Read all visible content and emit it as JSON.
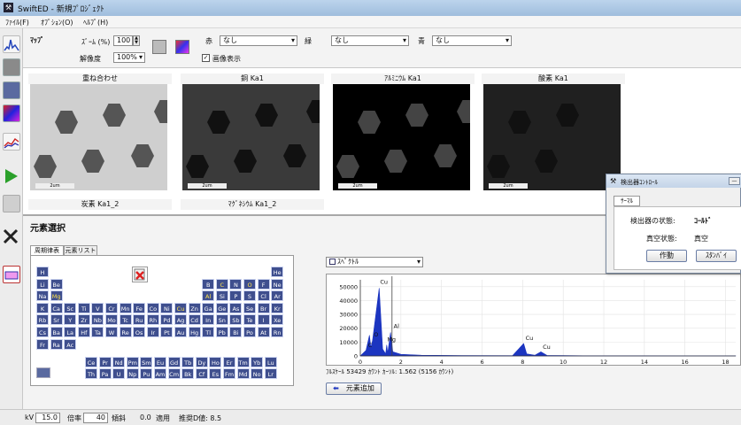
{
  "window": {
    "title": "SwiftED - 新規ﾌﾟﾛｼﾞｪｸﾄ"
  },
  "menu": [
    "ﾌｧｲﾙ(F)",
    "ｵﾌﾟｼｮﾝ(O)",
    "ﾍﾙﾌﾟ(H)"
  ],
  "map_panel": {
    "section_label": "ﾏｯﾌﾟ",
    "zoom_label": "ｽﾞｰﾑ (%)",
    "zoom_value": "100",
    "resolution_label": "解像度",
    "resolution_value": "100%",
    "red_label": "赤",
    "red_value": "なし",
    "green_label": "緑",
    "green_value": "なし",
    "blue_label": "青",
    "blue_value": "なし",
    "image_display_label": "画像表示",
    "maps": [
      {
        "caption": "重ね合わせ",
        "scale": "2um"
      },
      {
        "caption": "銅 Ka1",
        "scale": "2um"
      },
      {
        "caption": "ｱﾙﾐﾆｳﾑ Ka1",
        "scale": "2um"
      },
      {
        "caption": "酸素 Ka1",
        "scale": "2um"
      }
    ],
    "second_row_captions": [
      "炭素 Ka1_2",
      "ﾏｸﾞﾈｼｳﾑ Ka1_2"
    ]
  },
  "element_section": {
    "title": "元素選択",
    "tabs": [
      "周期律表",
      "元素リスト"
    ],
    "periodic_rows": [
      [
        "H",
        "",
        "",
        "",
        "",
        "",
        "",
        "",
        "",
        "",
        "",
        "",
        "",
        "",
        "",
        "",
        "",
        "He"
      ],
      [
        "Li",
        "Be",
        "",
        "",
        "",
        "",
        "",
        "",
        "",
        "",
        "",
        "",
        "B",
        "C",
        "N",
        "O",
        "F",
        "Ne"
      ],
      [
        "Na",
        "Mg",
        "",
        "",
        "",
        "",
        "",
        "",
        "",
        "",
        "",
        "",
        "Al",
        "Si",
        "P",
        "S",
        "Cl",
        "Ar"
      ],
      [
        "K",
        "Ca",
        "Sc",
        "Ti",
        "V",
        "Cr",
        "Mn",
        "Fe",
        "Co",
        "Ni",
        "Cu",
        "Zn",
        "Ga",
        "Ge",
        "As",
        "Se",
        "Br",
        "Kr"
      ],
      [
        "Rb",
        "Sr",
        "Y",
        "Zr",
        "Nb",
        "Mo",
        "Tc",
        "Ru",
        "Rh",
        "Pd",
        "Ag",
        "Cd",
        "In",
        "Sn",
        "Sb",
        "Te",
        "I",
        "Xe"
      ],
      [
        "Cs",
        "Ba",
        "La",
        "Hf",
        "Ta",
        "W",
        "Re",
        "Os",
        "Ir",
        "Pt",
        "Au",
        "Hg",
        "Tl",
        "Pb",
        "Bi",
        "Po",
        "At",
        "Rn"
      ],
      [
        "Fr",
        "Ra",
        "Ac",
        "",
        "",
        "",
        "",
        "",
        "",
        "",
        "",
        "",
        "",
        "",
        "",
        "",
        "",
        ""
      ]
    ],
    "lanthanides": [
      "Ce",
      "Pr",
      "Nd",
      "Pm",
      "Sm",
      "Eu",
      "Gd",
      "Tb",
      "Dy",
      "Ho",
      "Er",
      "Tm",
      "Yb",
      "Lu"
    ],
    "actinides": [
      "Th",
      "Pa",
      "U",
      "Np",
      "Pu",
      "Am",
      "Cm",
      "Bk",
      "Cf",
      "Es",
      "Fm",
      "Md",
      "No",
      "Lr"
    ],
    "highlighted": [
      "Mg",
      "Al",
      "Cu",
      "O",
      "C"
    ]
  },
  "spectrum": {
    "view_value": "ｽﾍﾟｸﾄﾙ",
    "fullscale_text": "ﾌﾙｽｹｰﾙ 53429 ｶｳﾝﾄ  ｶｰｿﾙ: 1.562  (5156 ｶｳﾝﾄ)",
    "add_element_label": "元素追加",
    "peak_labels": [
      "C",
      "O",
      "Cu",
      "Mg",
      "Al",
      "Cu",
      "Cu"
    ],
    "y_ticks": [
      "50000",
      "40000",
      "30000",
      "20000",
      "10000",
      "0"
    ],
    "x_ticks": [
      "0",
      "2",
      "4",
      "6",
      "8",
      "10",
      "12",
      "14",
      "16",
      "18"
    ]
  },
  "chart_data": {
    "type": "line",
    "title": "",
    "xlabel": "",
    "ylabel": "",
    "xlim": [
      0,
      18.5
    ],
    "ylim": [
      0,
      55000
    ],
    "x": [
      0,
      0.28,
      0.45,
      0.52,
      0.6,
      0.93,
      1.1,
      1.25,
      1.3,
      1.35,
      1.49,
      1.6,
      2.0,
      3.0,
      5.0,
      7.5,
      8.05,
      8.2,
      8.6,
      8.9,
      9.2,
      11.0,
      14.0,
      18.5
    ],
    "y": [
      0,
      4000,
      15000,
      6000,
      11000,
      49000,
      5000,
      1500,
      8000,
      2000,
      17000,
      3000,
      1200,
      500,
      300,
      200,
      9000,
      1500,
      500,
      3000,
      400,
      150,
      100,
      50
    ],
    "cursor_x": 1.562
  },
  "detector_dialog": {
    "title": "検出器ｺﾝﾄﾛｰﾙ",
    "tab": "ｻｰﾏﾙ",
    "status_label": "検出器の状態:",
    "status_value": "ｺｰﾙﾄﾞ",
    "vacuum_label": "真空状態:",
    "vacuum_value": "真空",
    "operate_label": "作動",
    "standby_label": "ｽﾀﾝﾊﾞｲ"
  },
  "statusbar": {
    "kv_label": "kV",
    "kv_value": "15.0",
    "mag_label": "倍率",
    "mag_value": "40",
    "tilt_label": "傾斜",
    "tilt_value": "0.0",
    "apply_label": "適用",
    "estimate_text": "推奨D値: 8.5"
  },
  "colors": {
    "element_cell": "#3f4f8e",
    "spectrum_fill": "#1c35c0",
    "highlight": "#ffe34a"
  }
}
